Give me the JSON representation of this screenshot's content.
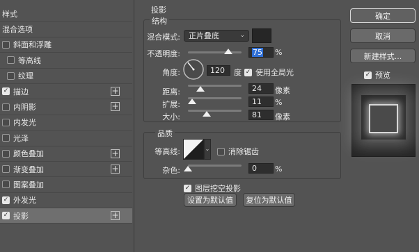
{
  "sidebar": {
    "items": [
      {
        "label": "样式",
        "has_checkbox": false,
        "checked": false,
        "has_plus": false,
        "indent": 0,
        "selected": false
      },
      {
        "label": "混合选项",
        "has_checkbox": false,
        "checked": false,
        "has_plus": false,
        "indent": 0,
        "selected": false
      },
      {
        "label": "斜面和浮雕",
        "has_checkbox": true,
        "checked": false,
        "has_plus": false,
        "indent": 0,
        "selected": false
      },
      {
        "label": "等高线",
        "has_checkbox": true,
        "checked": false,
        "has_plus": false,
        "indent": 1,
        "selected": false
      },
      {
        "label": "纹理",
        "has_checkbox": true,
        "checked": false,
        "has_plus": false,
        "indent": 1,
        "selected": false
      },
      {
        "label": "描边",
        "has_checkbox": true,
        "checked": true,
        "has_plus": true,
        "indent": 0,
        "selected": false
      },
      {
        "label": "内阴影",
        "has_checkbox": true,
        "checked": false,
        "has_plus": true,
        "indent": 0,
        "selected": false
      },
      {
        "label": "内发光",
        "has_checkbox": true,
        "checked": false,
        "has_plus": false,
        "indent": 0,
        "selected": false
      },
      {
        "label": "光泽",
        "has_checkbox": true,
        "checked": false,
        "has_plus": false,
        "indent": 0,
        "selected": false
      },
      {
        "label": "颜色叠加",
        "has_checkbox": true,
        "checked": false,
        "has_plus": true,
        "indent": 0,
        "selected": false
      },
      {
        "label": "渐变叠加",
        "has_checkbox": true,
        "checked": false,
        "has_plus": true,
        "indent": 0,
        "selected": false
      },
      {
        "label": "图案叠加",
        "has_checkbox": true,
        "checked": false,
        "has_plus": false,
        "indent": 0,
        "selected": false
      },
      {
        "label": "外发光",
        "has_checkbox": true,
        "checked": true,
        "has_plus": false,
        "indent": 0,
        "selected": false
      },
      {
        "label": "投影",
        "has_checkbox": true,
        "checked": true,
        "has_plus": true,
        "indent": 0,
        "selected": true
      }
    ],
    "plus_glyph": "+",
    "check_glyph": "✓"
  },
  "panel": {
    "title": "投影",
    "structure": {
      "title": "结构",
      "blend_mode_label": "混合模式:",
      "blend_mode_value": "正片叠底",
      "shadow_color": "#262626",
      "opacity_label": "不透明度:",
      "opacity_value": "75",
      "opacity_level": 75,
      "opacity_unit": "%",
      "angle_label": "角度:",
      "angle_value": "120",
      "angle_unit": "度",
      "global_light_label": "使用全局光",
      "global_light_checked": true,
      "distance_label": "距离:",
      "distance_value": "24",
      "distance_unit": "像素",
      "spread_label": "扩展:",
      "spread_value": "11",
      "spread_unit": "%",
      "size_label": "大小:",
      "size_value": "81",
      "size_unit": "像素"
    },
    "quality": {
      "title": "品质",
      "contour_label": "等高线:",
      "anti_alias_label": "消除锯齿",
      "anti_alias_checked": false,
      "noise_label": "杂色:",
      "noise_value": "0",
      "noise_unit": "%"
    },
    "knockout_label": "图层挖空投影",
    "knockout_checked": true,
    "make_default_label": "设置为默认值",
    "reset_default_label": "复位为默认值"
  },
  "right": {
    "ok_label": "确定",
    "cancel_label": "取消",
    "new_style_label": "新建样式...",
    "preview_label": "预览",
    "preview_checked": true
  },
  "colors": {
    "background": "#535353",
    "selected_row": "#6f6f6f",
    "field": "#2e2e2e",
    "highlight": "#2f6fd6"
  }
}
